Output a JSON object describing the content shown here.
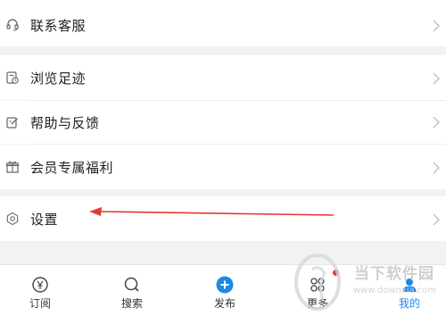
{
  "menu": {
    "items": [
      {
        "id": "contact",
        "label": "联系客服",
        "icon": "headset-icon"
      },
      {
        "id": "history",
        "label": "浏览足迹",
        "icon": "history-icon"
      },
      {
        "id": "feedback",
        "label": "帮助与反馈",
        "icon": "edit-icon"
      },
      {
        "id": "benefits",
        "label": "会员专属福利",
        "icon": "gift-icon"
      },
      {
        "id": "settings",
        "label": "设置",
        "icon": "gear-icon"
      }
    ]
  },
  "tabbar": {
    "tabs": [
      {
        "label": "订阅",
        "icon": "yen-circle-icon"
      },
      {
        "label": "搜索",
        "icon": "search-icon"
      },
      {
        "label": "发布",
        "icon": "plus-circle-icon"
      },
      {
        "label": "更多",
        "icon": "grid-icon"
      },
      {
        "label": "我的",
        "icon": "user-icon",
        "active": true
      }
    ]
  },
  "watermark": {
    "brand": "当下软件园",
    "url": "www.downxia.com"
  },
  "colors": {
    "accent": "#1e88e5",
    "annotation_arrow": "#e53935",
    "background": "#f2f2f2"
  }
}
